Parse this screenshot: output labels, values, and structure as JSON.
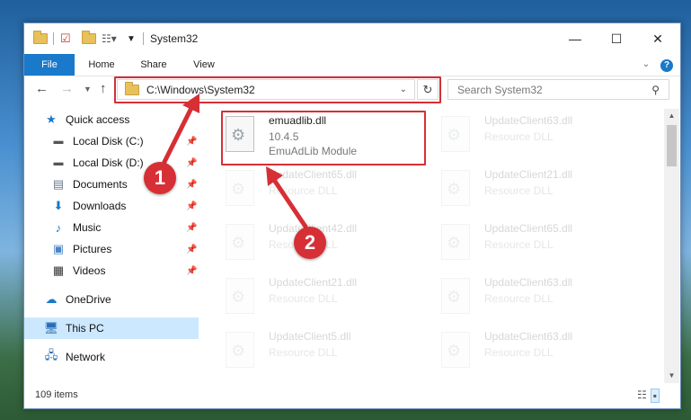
{
  "window": {
    "title": "System32",
    "controls": [
      "—",
      "☐",
      "✕"
    ]
  },
  "ribbon": {
    "tabs": [
      "File",
      "Home",
      "Share",
      "View"
    ]
  },
  "address_bar": {
    "path": "C:\\Windows\\System32",
    "search_placeholder": "Search System32"
  },
  "nav_pane": {
    "quick_access": "Quick access",
    "items": [
      {
        "label": "Local Disk (C:)",
        "icon": "drive-icon",
        "pinned": true
      },
      {
        "label": "Local Disk (D:)",
        "icon": "drive-icon",
        "pinned": true
      },
      {
        "label": "Documents",
        "icon": "documents-icon",
        "pinned": true
      },
      {
        "label": "Downloads",
        "icon": "downloads-icon",
        "pinned": true
      },
      {
        "label": "Music",
        "icon": "music-icon",
        "pinned": true
      },
      {
        "label": "Pictures",
        "icon": "pictures-icon",
        "pinned": true
      },
      {
        "label": "Videos",
        "icon": "videos-icon",
        "pinned": true
      }
    ],
    "onedrive": "OneDrive",
    "this_pc": "This PC",
    "network": "Network"
  },
  "files": {
    "highlighted": {
      "name": "emuadlib.dll",
      "version": "10.4.5",
      "description": "EmuAdLib Module"
    },
    "faded": [
      {
        "name": "UpdateClient63.dll",
        "description": "Resource DLL"
      },
      {
        "name": "UpdateClient65.dll",
        "description": "Resource DLL"
      },
      {
        "name": "UpdateClient21.dll",
        "description": "Resource DLL"
      },
      {
        "name": "UpdateClient42.dll",
        "description": "Resource DLL"
      },
      {
        "name": "UpdateClient65.dll",
        "description": "Resource DLL"
      },
      {
        "name": "UpdateClient21.dll",
        "description": "Resource DLL"
      },
      {
        "name": "UpdateClient63.dll",
        "description": "Resource DLL"
      },
      {
        "name": "UpdateClient5.dll",
        "description": "Resource DLL"
      },
      {
        "name": "UpdateClient63.dll",
        "description": "Resource DLL"
      }
    ]
  },
  "status": {
    "item_count": "109 items"
  },
  "markers": {
    "one": "1",
    "two": "2"
  },
  "colors": {
    "accent": "#1979ca",
    "highlight": "#d62f35",
    "selected": "#cce8ff"
  }
}
